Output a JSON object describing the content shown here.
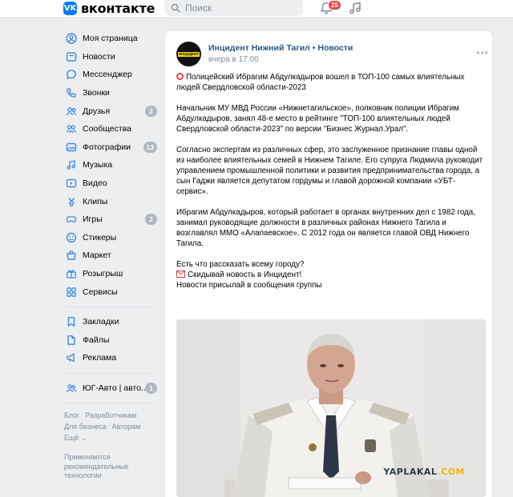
{
  "header": {
    "logo_badge": "VK",
    "logo_text": "вконтакте",
    "search_placeholder": "Поиск",
    "notifications_count": "25"
  },
  "sidebar": {
    "items": [
      {
        "label": "Моя страница",
        "icon": "user-circle-icon"
      },
      {
        "label": "Новости",
        "icon": "newspaper-icon"
      },
      {
        "label": "Мессенджер",
        "icon": "message-icon"
      },
      {
        "label": "Звонки",
        "icon": "phone-icon"
      },
      {
        "label": "Друзья",
        "icon": "users-icon",
        "count": "2"
      },
      {
        "label": "Сообщества",
        "icon": "communities-icon"
      },
      {
        "label": "Фотографии",
        "icon": "photo-icon",
        "count": "13"
      },
      {
        "label": "Музыка",
        "icon": "music-icon"
      },
      {
        "label": "Видео",
        "icon": "video-icon"
      },
      {
        "label": "Клипы",
        "icon": "clips-icon"
      },
      {
        "label": "Игры",
        "icon": "gamepad-icon",
        "count": "2"
      },
      {
        "label": "Стикеры",
        "icon": "sticker-icon"
      },
      {
        "label": "Маркет",
        "icon": "market-icon"
      },
      {
        "label": "Розыгрыш",
        "icon": "gift-icon"
      },
      {
        "label": "Сервисы",
        "icon": "services-icon"
      }
    ],
    "items2": [
      {
        "label": "Закладки",
        "icon": "bookmark-icon"
      },
      {
        "label": "Файлы",
        "icon": "file-icon"
      },
      {
        "label": "Реклама",
        "icon": "megaphone-icon"
      }
    ],
    "items3": [
      {
        "label": "ЮГ-Авто | авто...",
        "icon": "group-icon",
        "count": "1"
      }
    ],
    "footer": {
      "blog": "Блог",
      "developers": "Разработчикам",
      "business": "Для бизнеса",
      "authors": "Авторам",
      "more": "Ещё ⌄",
      "note": "Применяются рекомендательные технологии"
    }
  },
  "post": {
    "author": "Инцидент Нижний Тагил • Новости",
    "time": "вчера в 17:00",
    "avatar_text": "ИНЦИДЕНТ",
    "p1": "Полицейский Ибрагим Абдулкадыров вошел в ТОП-100 самых влиятельных людей Свердловской области-2023",
    "p2": "Начальник МУ МВД России «Нижнетагильское», полковник полиции Ибрагим Абдулкадыров, занял 48-е место в рейтинге \"ТОП-100 влиятельных людей Свердловской области-2023\" по версии \"Бизнес Журнал.Урал\".",
    "p3": "Согласно экспертам из различных сфер, это заслуженное признание главы одной из наиболее влиятельных семей в Нижнем Тагиле. Его супруга Людмила руководит управлением промышленной политики и развития предпринимательства города, а сын Гаджи является депутатом гордумы и главой дорожной компании «УБТ-сервис».",
    "p4": "Ибрагим Абдулкадыров, который работает в органах внутренних дел с 1982 года, занимал руководящие должности в различных районах Нижнего Тагила и возглавлял ММО «Алапаевское». С 2012 года он является главой ОВД Нижнего Тагила.",
    "p5_line1": "Есть что рассказать всему городу?",
    "p5_line2": "Скидывай новость в Инцидент!",
    "p5_line3": "Новости присылай в сообщения группы",
    "watermark_a": "YAPLAKAL",
    "watermark_b": ".COM"
  }
}
